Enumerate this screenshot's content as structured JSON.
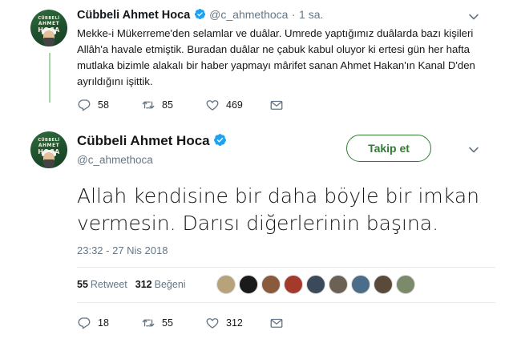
{
  "tweet_prev": {
    "author_name": "Cübbeli Ahmet Hoca",
    "author_handle": "@c_ahmethoca",
    "separator": "·",
    "time_ago": "1 sa.",
    "text": "Mekke-i Mükerreme'den selamlar ve duâlar. Umrede yaptığımız duâlarda bazı kişileri Allâh'a havale etmiştik. Buradan duâlar ne çabuk kabul oluyor ki ertesi gün her hafta mutlaka bizimle alakalı bir haber yapmayı mârifet sanan Ahmet Hakan'ın Kanal D'den ayrıldığını işittik.",
    "reply_count": "58",
    "retweet_count": "85",
    "like_count": "469"
  },
  "avatar": {
    "line1": "CÜBBELİ",
    "line2": "AHMET",
    "line3": "HOCA"
  },
  "tweet_main": {
    "author_name": "Cübbeli Ahmet Hoca",
    "author_handle": "@c_ahmethoca",
    "follow_label": "Takip et",
    "text": "Allah kendisine bir daha böyle bir imkan vermesin. Darısı diğerlerinin başına.",
    "timestamp": "23:32 - 27 Nis 2018",
    "retweet_total": "55",
    "retweet_label": "Retweet",
    "like_total": "312",
    "like_label": "Beğeni",
    "reply_count": "18",
    "retweet_count": "55",
    "like_count": "312"
  },
  "liker_avatars": [
    {
      "name": "liker-1",
      "color": "#b8a27a"
    },
    {
      "name": "liker-2",
      "color": "#1a1a1a"
    },
    {
      "name": "liker-3",
      "color": "#8a5a3c"
    },
    {
      "name": "liker-4",
      "color": "#a33a2c"
    },
    {
      "name": "liker-5",
      "color": "#3a4a5a"
    },
    {
      "name": "liker-6",
      "color": "#6b6155"
    },
    {
      "name": "liker-7",
      "color": "#4b6d8a"
    },
    {
      "name": "liker-8",
      "color": "#5a4a3a"
    },
    {
      "name": "liker-9",
      "color": "#7a8a6a"
    }
  ],
  "colors": {
    "verified": "#1da1f2",
    "accent_green": "#2e7d32",
    "muted": "#657786"
  }
}
